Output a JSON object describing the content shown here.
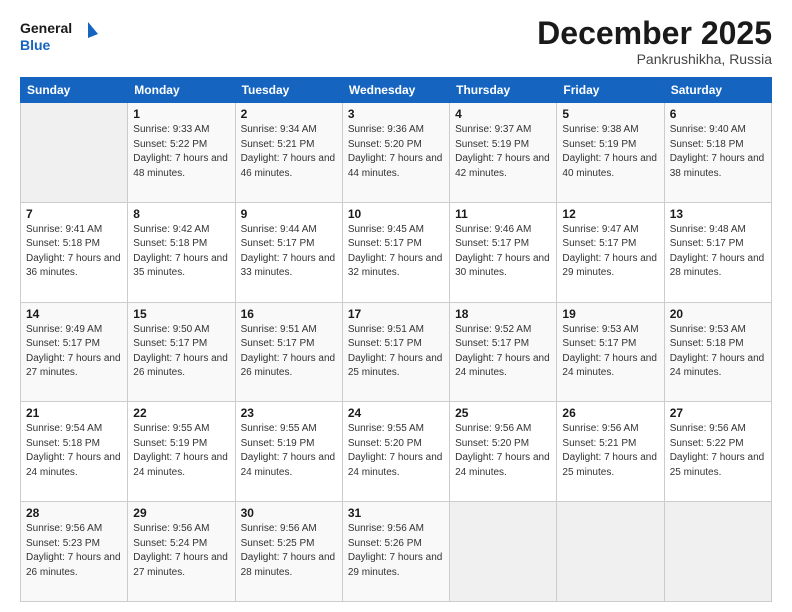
{
  "header": {
    "logo_line1": "General",
    "logo_line2": "Blue",
    "month": "December 2025",
    "location": "Pankrushikha, Russia"
  },
  "days_of_week": [
    "Sunday",
    "Monday",
    "Tuesday",
    "Wednesday",
    "Thursday",
    "Friday",
    "Saturday"
  ],
  "weeks": [
    [
      {
        "num": "",
        "sunrise": "",
        "sunset": "",
        "daylight": ""
      },
      {
        "num": "1",
        "sunrise": "Sunrise: 9:33 AM",
        "sunset": "Sunset: 5:22 PM",
        "daylight": "Daylight: 7 hours and 48 minutes."
      },
      {
        "num": "2",
        "sunrise": "Sunrise: 9:34 AM",
        "sunset": "Sunset: 5:21 PM",
        "daylight": "Daylight: 7 hours and 46 minutes."
      },
      {
        "num": "3",
        "sunrise": "Sunrise: 9:36 AM",
        "sunset": "Sunset: 5:20 PM",
        "daylight": "Daylight: 7 hours and 44 minutes."
      },
      {
        "num": "4",
        "sunrise": "Sunrise: 9:37 AM",
        "sunset": "Sunset: 5:19 PM",
        "daylight": "Daylight: 7 hours and 42 minutes."
      },
      {
        "num": "5",
        "sunrise": "Sunrise: 9:38 AM",
        "sunset": "Sunset: 5:19 PM",
        "daylight": "Daylight: 7 hours and 40 minutes."
      },
      {
        "num": "6",
        "sunrise": "Sunrise: 9:40 AM",
        "sunset": "Sunset: 5:18 PM",
        "daylight": "Daylight: 7 hours and 38 minutes."
      }
    ],
    [
      {
        "num": "7",
        "sunrise": "Sunrise: 9:41 AM",
        "sunset": "Sunset: 5:18 PM",
        "daylight": "Daylight: 7 hours and 36 minutes."
      },
      {
        "num": "8",
        "sunrise": "Sunrise: 9:42 AM",
        "sunset": "Sunset: 5:18 PM",
        "daylight": "Daylight: 7 hours and 35 minutes."
      },
      {
        "num": "9",
        "sunrise": "Sunrise: 9:44 AM",
        "sunset": "Sunset: 5:17 PM",
        "daylight": "Daylight: 7 hours and 33 minutes."
      },
      {
        "num": "10",
        "sunrise": "Sunrise: 9:45 AM",
        "sunset": "Sunset: 5:17 PM",
        "daylight": "Daylight: 7 hours and 32 minutes."
      },
      {
        "num": "11",
        "sunrise": "Sunrise: 9:46 AM",
        "sunset": "Sunset: 5:17 PM",
        "daylight": "Daylight: 7 hours and 30 minutes."
      },
      {
        "num": "12",
        "sunrise": "Sunrise: 9:47 AM",
        "sunset": "Sunset: 5:17 PM",
        "daylight": "Daylight: 7 hours and 29 minutes."
      },
      {
        "num": "13",
        "sunrise": "Sunrise: 9:48 AM",
        "sunset": "Sunset: 5:17 PM",
        "daylight": "Daylight: 7 hours and 28 minutes."
      }
    ],
    [
      {
        "num": "14",
        "sunrise": "Sunrise: 9:49 AM",
        "sunset": "Sunset: 5:17 PM",
        "daylight": "Daylight: 7 hours and 27 minutes."
      },
      {
        "num": "15",
        "sunrise": "Sunrise: 9:50 AM",
        "sunset": "Sunset: 5:17 PM",
        "daylight": "Daylight: 7 hours and 26 minutes."
      },
      {
        "num": "16",
        "sunrise": "Sunrise: 9:51 AM",
        "sunset": "Sunset: 5:17 PM",
        "daylight": "Daylight: 7 hours and 26 minutes."
      },
      {
        "num": "17",
        "sunrise": "Sunrise: 9:51 AM",
        "sunset": "Sunset: 5:17 PM",
        "daylight": "Daylight: 7 hours and 25 minutes."
      },
      {
        "num": "18",
        "sunrise": "Sunrise: 9:52 AM",
        "sunset": "Sunset: 5:17 PM",
        "daylight": "Daylight: 7 hours and 24 minutes."
      },
      {
        "num": "19",
        "sunrise": "Sunrise: 9:53 AM",
        "sunset": "Sunset: 5:17 PM",
        "daylight": "Daylight: 7 hours and 24 minutes."
      },
      {
        "num": "20",
        "sunrise": "Sunrise: 9:53 AM",
        "sunset": "Sunset: 5:18 PM",
        "daylight": "Daylight: 7 hours and 24 minutes."
      }
    ],
    [
      {
        "num": "21",
        "sunrise": "Sunrise: 9:54 AM",
        "sunset": "Sunset: 5:18 PM",
        "daylight": "Daylight: 7 hours and 24 minutes."
      },
      {
        "num": "22",
        "sunrise": "Sunrise: 9:55 AM",
        "sunset": "Sunset: 5:19 PM",
        "daylight": "Daylight: 7 hours and 24 minutes."
      },
      {
        "num": "23",
        "sunrise": "Sunrise: 9:55 AM",
        "sunset": "Sunset: 5:19 PM",
        "daylight": "Daylight: 7 hours and 24 minutes."
      },
      {
        "num": "24",
        "sunrise": "Sunrise: 9:55 AM",
        "sunset": "Sunset: 5:20 PM",
        "daylight": "Daylight: 7 hours and 24 minutes."
      },
      {
        "num": "25",
        "sunrise": "Sunrise: 9:56 AM",
        "sunset": "Sunset: 5:20 PM",
        "daylight": "Daylight: 7 hours and 24 minutes."
      },
      {
        "num": "26",
        "sunrise": "Sunrise: 9:56 AM",
        "sunset": "Sunset: 5:21 PM",
        "daylight": "Daylight: 7 hours and 25 minutes."
      },
      {
        "num": "27",
        "sunrise": "Sunrise: 9:56 AM",
        "sunset": "Sunset: 5:22 PM",
        "daylight": "Daylight: 7 hours and 25 minutes."
      }
    ],
    [
      {
        "num": "28",
        "sunrise": "Sunrise: 9:56 AM",
        "sunset": "Sunset: 5:23 PM",
        "daylight": "Daylight: 7 hours and 26 minutes."
      },
      {
        "num": "29",
        "sunrise": "Sunrise: 9:56 AM",
        "sunset": "Sunset: 5:24 PM",
        "daylight": "Daylight: 7 hours and 27 minutes."
      },
      {
        "num": "30",
        "sunrise": "Sunrise: 9:56 AM",
        "sunset": "Sunset: 5:25 PM",
        "daylight": "Daylight: 7 hours and 28 minutes."
      },
      {
        "num": "31",
        "sunrise": "Sunrise: 9:56 AM",
        "sunset": "Sunset: 5:26 PM",
        "daylight": "Daylight: 7 hours and 29 minutes."
      },
      {
        "num": "",
        "sunrise": "",
        "sunset": "",
        "daylight": ""
      },
      {
        "num": "",
        "sunrise": "",
        "sunset": "",
        "daylight": ""
      },
      {
        "num": "",
        "sunrise": "",
        "sunset": "",
        "daylight": ""
      }
    ]
  ]
}
